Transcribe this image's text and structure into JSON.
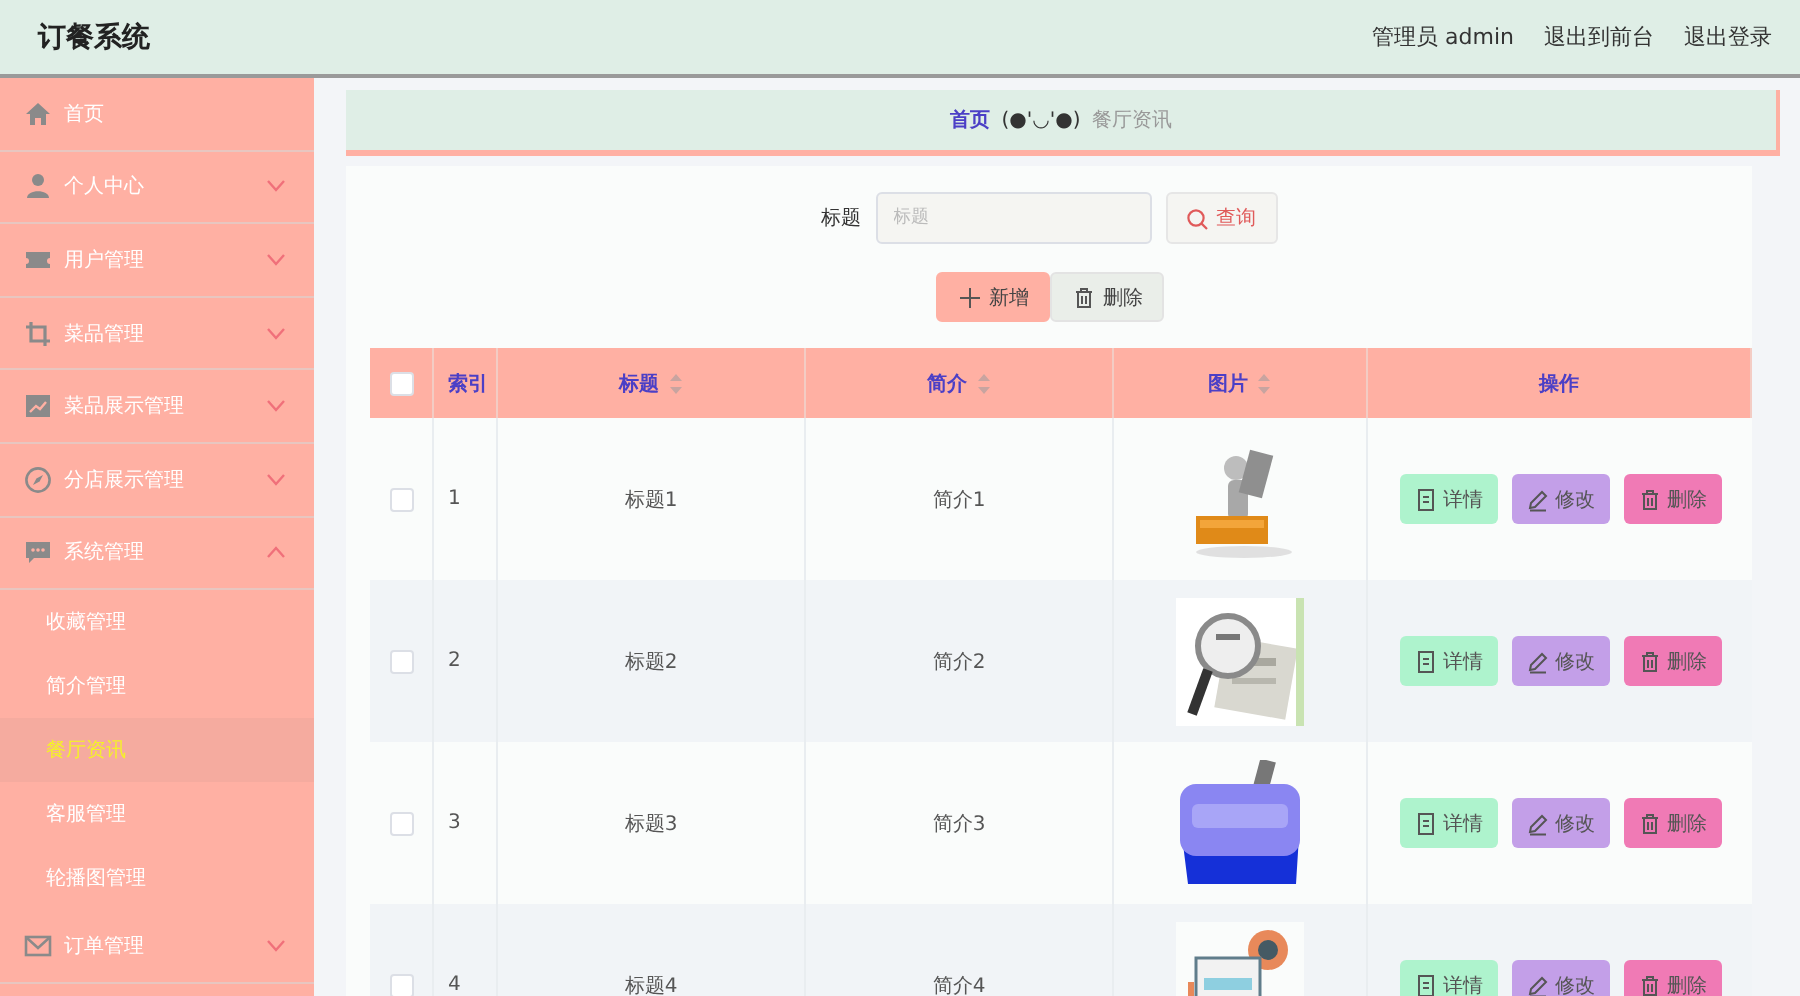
{
  "header": {
    "title": "订餐系统",
    "links": [
      "管理员 admin",
      "退出到前台",
      "退出登录"
    ]
  },
  "sidebar": {
    "items": [
      {
        "label": "首页"
      },
      {
        "label": "个人中心",
        "expanded": false
      },
      {
        "label": "用户管理",
        "expanded": false
      },
      {
        "label": "菜品管理",
        "expanded": false
      },
      {
        "label": "菜品展示管理",
        "expanded": false
      },
      {
        "label": "分店展示管理",
        "expanded": false
      },
      {
        "label": "系统管理",
        "expanded": true,
        "children": [
          {
            "label": "收藏管理",
            "selected": false
          },
          {
            "label": "简介管理",
            "selected": false
          },
          {
            "label": "餐厅资讯",
            "selected": true
          },
          {
            "label": "客服管理",
            "selected": false
          },
          {
            "label": "轮播图管理",
            "selected": false
          }
        ]
      },
      {
        "label": "订单管理",
        "expanded": false
      }
    ]
  },
  "breadcrumb": {
    "home": "首页",
    "separator": "(●'◡'●)",
    "current": "餐厅资讯"
  },
  "search": {
    "label": "标题",
    "placeholder": "标题",
    "button": "查询"
  },
  "actions": [
    {
      "kind": "add",
      "label": "新增"
    },
    {
      "kind": "delete",
      "label": "删除"
    }
  ],
  "table": {
    "select_all": {
      "checked": false
    },
    "columns": [
      {
        "label": "索引",
        "sortable": false
      },
      {
        "label": "标题",
        "sortable": true
      },
      {
        "label": "简介",
        "sortable": true
      },
      {
        "label": "图片",
        "sortable": true
      },
      {
        "label": "操作",
        "sortable": false
      }
    ],
    "rows": [
      {
        "checked": false,
        "index": "1",
        "title": "标题1",
        "intro": "简介1",
        "picture": {
          "kind": "picture"
        },
        "buttons": [
          {
            "kind": "detail",
            "label": "详情"
          },
          {
            "kind": "edit",
            "label": "修改"
          },
          {
            "kind": "delete",
            "label": "删除"
          }
        ]
      },
      {
        "checked": false,
        "index": "2",
        "title": "标题2",
        "intro": "简介2",
        "picture": {
          "kind": "picture"
        },
        "buttons": [
          {
            "kind": "detail",
            "label": "详情"
          },
          {
            "kind": "edit",
            "label": "修改"
          },
          {
            "kind": "delete",
            "label": "删除"
          }
        ]
      },
      {
        "checked": false,
        "index": "3",
        "title": "标题3",
        "intro": "简介3",
        "picture": {
          "kind": "picture"
        },
        "buttons": [
          {
            "kind": "detail",
            "label": "详情"
          },
          {
            "kind": "edit",
            "label": "修改"
          },
          {
            "kind": "delete",
            "label": "删除"
          }
        ]
      },
      {
        "checked": false,
        "index": "4",
        "title": "标题4",
        "intro": "简介4",
        "picture": {
          "kind": "picture"
        },
        "buttons": [
          {
            "kind": "detail",
            "label": "详情"
          },
          {
            "kind": "edit",
            "label": "修改"
          },
          {
            "kind": "delete",
            "label": "删除"
          }
        ]
      }
    ]
  }
}
